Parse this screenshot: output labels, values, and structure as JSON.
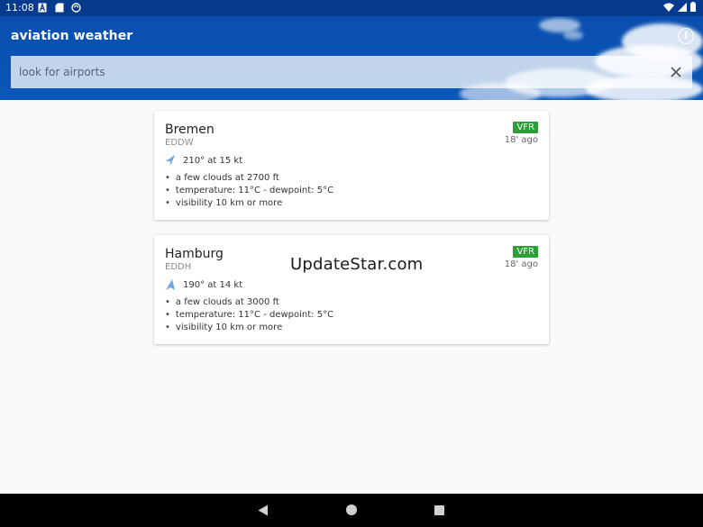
{
  "status_bar": {
    "time": "11:08"
  },
  "app": {
    "title": "aviation weather",
    "search_placeholder": "look for airports",
    "search_value": ""
  },
  "airports": [
    {
      "name": "Bremen",
      "code": "EDDW",
      "flight_category": "VFR",
      "age": "18' ago",
      "wind": "210° at 15 kt",
      "wind_direction_deg": 210,
      "details": [
        "a few clouds at 2700 ft",
        "temperature: 11°C - dewpoint: 5°C",
        "visibility 10 km or more"
      ]
    },
    {
      "name": "Hamburg",
      "code": "EDDH",
      "flight_category": "VFR",
      "age": "18' ago",
      "wind": "190° at 14 kt",
      "wind_direction_deg": 190,
      "details": [
        "a few clouds at 3000 ft",
        "temperature: 11°C - dewpoint: 5°C",
        "visibility 10 km or more"
      ]
    }
  ],
  "watermark": "UpdateStar.com",
  "colors": {
    "app_bar": "#0b57b8",
    "status_bar": "#063a8c",
    "vfr_badge": "#2e9e37",
    "wind_arrow": "#6aa6e8"
  },
  "icons": {
    "info": "info-icon",
    "clear": "close-icon",
    "wind": "wind-arrow-icon",
    "nav_back": "back-triangle-icon",
    "nav_home": "home-circle-icon",
    "nav_recent": "recents-square-icon"
  }
}
